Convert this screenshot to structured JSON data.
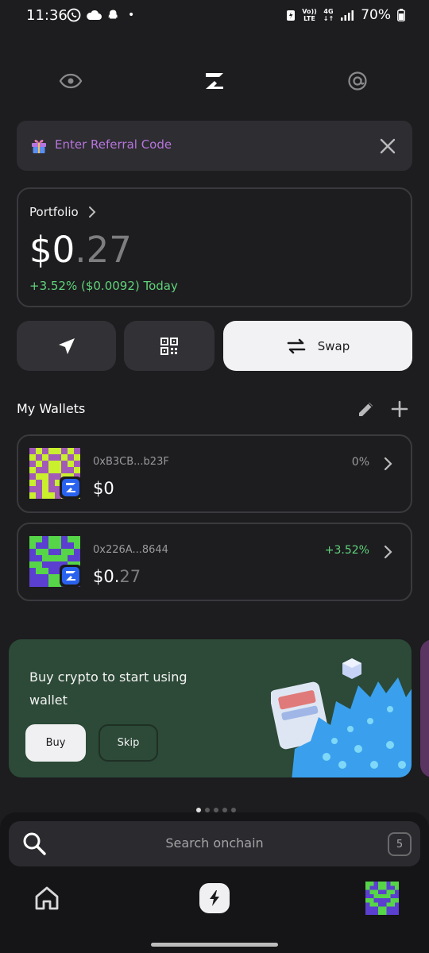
{
  "status_bar": {
    "time": "11:36",
    "dot": "•",
    "net_vo": "Vo))",
    "net_lte": "LTE",
    "net_4g": "4G",
    "battery": "70%",
    "left_icons": [
      "whatsapp-icon",
      "cloud-icon",
      "snapchat-icon"
    ],
    "right_icons": [
      "battery-saver-icon",
      "signal-icon",
      "battery-icon"
    ]
  },
  "top_nav": {
    "icons": [
      "eye-icon",
      "zerion-logo-icon",
      "at-sign-icon"
    ]
  },
  "referral": {
    "label": "Enter Referral Code",
    "icon": "gift-icon",
    "close_icon": "close-icon"
  },
  "portfolio": {
    "label": "Portfolio",
    "balance_whole": "$0",
    "balance_decimal": ".27",
    "change": "+3.52% ($0.0092) Today"
  },
  "actions": {
    "send_icon": "send-icon",
    "receive_icon": "qr-code-icon",
    "swap_label": "Swap",
    "swap_icon": "swap-icon"
  },
  "wallets": {
    "title": "My Wallets",
    "edit_icon": "pencil-icon",
    "add_icon": "plus-icon",
    "items": [
      {
        "address": "0xB3CB...b23F",
        "balance_whole": "$0",
        "balance_decimal": "",
        "change": "0%"
      },
      {
        "address": "0x226A...8644",
        "balance_whole": "$0.",
        "balance_decimal": "27",
        "change": "+3.52%"
      }
    ]
  },
  "promo": {
    "text": "Buy crypto to start using wallet",
    "buy_label": "Buy",
    "skip_label": "Skip"
  },
  "search": {
    "placeholder": "Search onchain",
    "count": "5"
  },
  "colors": {
    "background": "#1d1c1f",
    "positive": "#5fd37a",
    "promo": "#2c4a37",
    "referral_text": "#b675dc"
  }
}
